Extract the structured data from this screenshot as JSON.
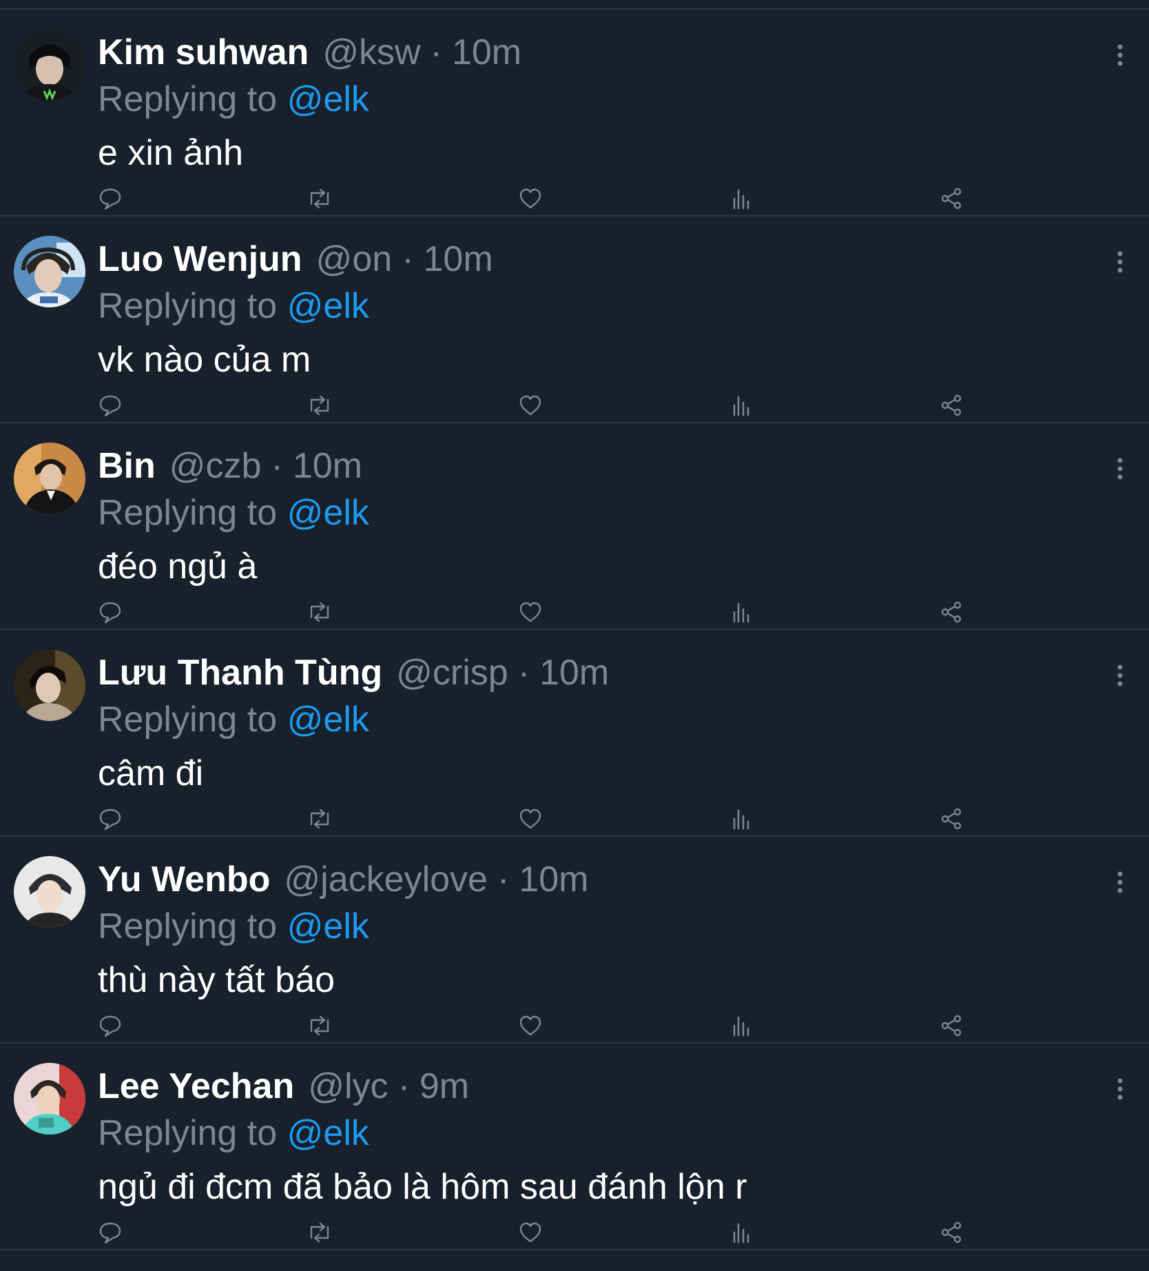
{
  "reply_prefix": "Replying to",
  "reply_target": "@elk",
  "separator": "·",
  "colors": {
    "background": "#17202b",
    "divider": "#2c3642",
    "muted": "#7b8794",
    "accent": "#1d9bf0",
    "text": "#ffffff"
  },
  "action_icons": [
    "reply-icon",
    "retweet-icon",
    "like-icon",
    "views-icon",
    "share-icon"
  ],
  "tweets": [
    {
      "name": "Kim suhwan",
      "handle": "@ksw",
      "time": "10m",
      "text": "e xin ảnh"
    },
    {
      "name": "Luo Wenjun",
      "handle": "@on",
      "time": "10m",
      "text": "vk nào của m"
    },
    {
      "name": "Bin",
      "handle": "@czb",
      "time": "10m",
      "text": "đéo ngủ à"
    },
    {
      "name": "Lưu Thanh Tùng",
      "handle": "@crisp",
      "time": "10m",
      "text": "câm đi"
    },
    {
      "name": "Yu Wenbo",
      "handle": "@jackeylove",
      "time": "10m",
      "text": "thù này tất báo"
    },
    {
      "name": "Lee Yechan",
      "handle": "@lyc",
      "time": "9m",
      "text": "ngủ đi đcm đã bảo là hôm sau đánh lộn r"
    }
  ]
}
